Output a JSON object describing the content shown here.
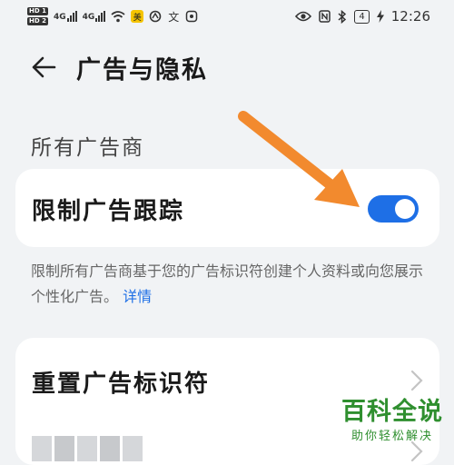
{
  "status_bar": {
    "hd1": "HD 1",
    "hd2": "HD 2",
    "net1": "4G",
    "net2": "4G",
    "app1_label": "美",
    "app2_label": "文",
    "battery": "4",
    "time": "12:26"
  },
  "header": {
    "title": "广告与隐私"
  },
  "section": {
    "title": "所有广告商"
  },
  "limit_tracking": {
    "label": "限制广告跟踪",
    "enabled": true
  },
  "description": {
    "text": "限制所有广告商基于您的广告标识符创建个人资料或向您展示个性化广告。",
    "link": "详情"
  },
  "reset": {
    "label": "重置广告标识符"
  },
  "watermark": {
    "title": "百科全说",
    "subtitle": "助你轻松解决"
  },
  "colors": {
    "accent": "#1e6fe6",
    "background": "#f1f3f5",
    "annotation": "#f28a2e",
    "watermark": "#2f8f2f"
  },
  "icons": {
    "back": "back-arrow-icon",
    "chevron": "chevron-right-icon",
    "eye": "eye-icon",
    "nfc": "nfc-icon",
    "bluetooth": "bluetooth-icon",
    "charging": "lightning-icon"
  }
}
